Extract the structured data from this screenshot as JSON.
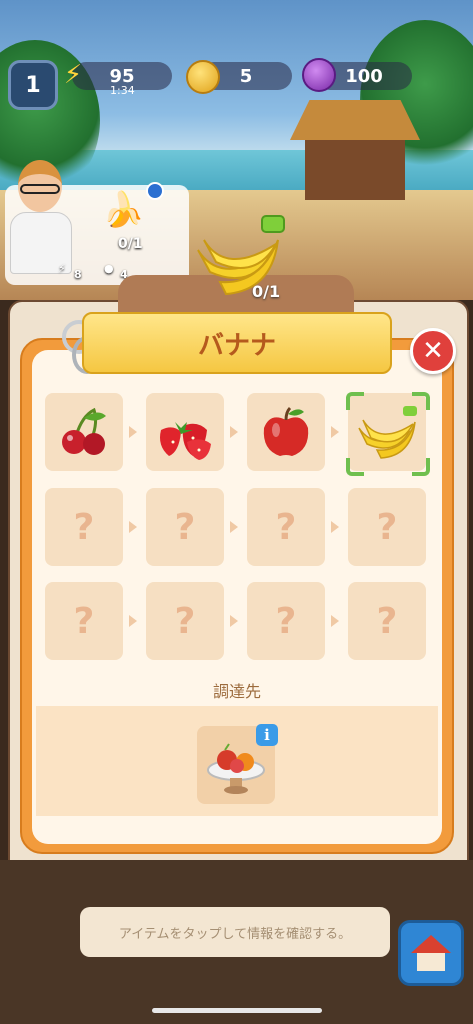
{
  "hud": {
    "level": "1",
    "energy": "95",
    "energy_timer": "1:34",
    "coins": "5",
    "gems": "100"
  },
  "order": {
    "count": "0/1",
    "reward_energy": "8",
    "reward_coins": "4"
  },
  "target": {
    "count": "0/1"
  },
  "panel": {
    "title": "バナナ",
    "close_symbol": "✕",
    "chain": [
      {
        "item": "cherry-icon",
        "state": "known"
      },
      {
        "item": "strawberry-icon",
        "state": "known"
      },
      {
        "item": "apple-icon",
        "state": "known"
      },
      {
        "item": "banana-icon",
        "state": "selected"
      },
      {
        "item": "?",
        "state": "unknown"
      },
      {
        "item": "?",
        "state": "unknown"
      },
      {
        "item": "?",
        "state": "unknown"
      },
      {
        "item": "?",
        "state": "unknown"
      },
      {
        "item": "?",
        "state": "unknown"
      },
      {
        "item": "?",
        "state": "unknown"
      },
      {
        "item": "?",
        "state": "unknown"
      },
      {
        "item": "?",
        "state": "unknown"
      }
    ],
    "unknown_mark": "?",
    "source_label": "調達先",
    "source_item": "fruit-bowl-icon",
    "info_symbol": "i"
  },
  "bottom": {
    "hint": "アイテムをタップして情報を確認する。"
  },
  "colors": {
    "panel_orange": "#f29b3c",
    "title_yellow": "#f5c742",
    "close_red": "#e0403c",
    "selection_green": "#6fbf4e",
    "info_blue": "#3a9be8"
  }
}
